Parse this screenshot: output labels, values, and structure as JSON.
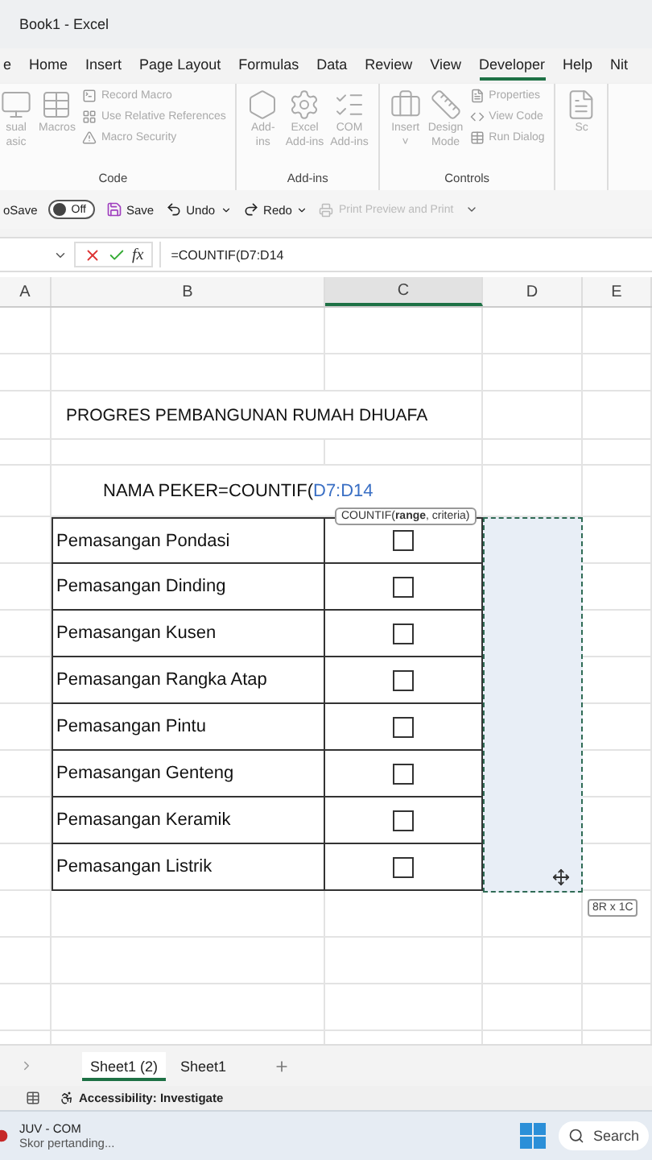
{
  "window": {
    "title": "Book1  -  Excel"
  },
  "ribbon_tabs": [
    {
      "label": "e",
      "selected": false
    },
    {
      "label": "Home",
      "selected": false
    },
    {
      "label": "Insert",
      "selected": false
    },
    {
      "label": "Page Layout",
      "selected": false
    },
    {
      "label": "Formulas",
      "selected": false
    },
    {
      "label": "Data",
      "selected": false
    },
    {
      "label": "Review",
      "selected": false
    },
    {
      "label": "View",
      "selected": false
    },
    {
      "label": "Developer",
      "selected": true
    },
    {
      "label": "Help",
      "selected": false
    },
    {
      "label": "Nit",
      "selected": false
    }
  ],
  "ribbon_groups": [
    {
      "label": "Code",
      "large": [
        {
          "label": "sual\nasic"
        },
        {
          "label": "Macros"
        }
      ],
      "small": [
        {
          "label": "Record Macro"
        },
        {
          "label": "Use Relative References"
        },
        {
          "label": "Macro Security"
        }
      ]
    },
    {
      "label": "Add-ins",
      "large": [
        {
          "label": "Add-\nins"
        },
        {
          "label": "Excel\nAdd-ins"
        },
        {
          "label": "COM\nAdd-ins"
        }
      ]
    },
    {
      "label": "Controls",
      "large": [
        {
          "label": "Insert\n˅"
        },
        {
          "label": "Design\nMode"
        }
      ],
      "small": [
        {
          "label": "Properties"
        },
        {
          "label": "View Code"
        },
        {
          "label": "Run Dialog"
        }
      ]
    },
    {
      "large": [
        {
          "label": "Sc"
        }
      ]
    }
  ],
  "quick_access": {
    "autosave_label": "oSave",
    "autosave": {
      "on": false,
      "label": "Off"
    },
    "save": "Save",
    "undo": "Undo",
    "redo": "Redo",
    "print": "Print Preview and Print"
  },
  "formula_bar": {
    "fx": "fx",
    "formula": "=COUNTIF(D7:D14"
  },
  "columns": [
    {
      "label": "A",
      "selected": false
    },
    {
      "label": "B",
      "selected": false
    },
    {
      "label": "C",
      "selected": true
    },
    {
      "label": "D",
      "selected": false
    },
    {
      "label": "E",
      "selected": false
    }
  ],
  "rows": [
    {
      "kind": "blank"
    },
    {
      "kind": "blank"
    },
    {
      "kind": "title",
      "text": "PROGRES PEMBANGUNAN RUMAH DHUAFA"
    },
    {
      "kind": "blank"
    },
    {
      "kind": "formula",
      "text": "NAMA PEKER=COUNTIF(",
      "range": "D7:D14"
    },
    {
      "kind": "task",
      "text": "Pemasangan Pondasi",
      "checked": false
    },
    {
      "kind": "task",
      "text": "Pemasangan Dinding",
      "checked": false
    },
    {
      "kind": "task",
      "text": "Pemasangan Kusen",
      "checked": false
    },
    {
      "kind": "task",
      "text": "Pemasangan Rangka Atap",
      "checked": false
    },
    {
      "kind": "task",
      "text": "Pemasangan Pintu",
      "checked": false
    },
    {
      "kind": "task",
      "text": "Pemasangan Genteng",
      "checked": false
    },
    {
      "kind": "task",
      "text": "Pemasangan Keramik",
      "checked": false
    },
    {
      "kind": "task",
      "text": "Pemasangan Listrik",
      "checked": false
    },
    {
      "kind": "blank"
    },
    {
      "kind": "blank"
    },
    {
      "kind": "blank"
    },
    {
      "kind": "blank"
    }
  ],
  "function_tooltip": "COUNTIF(**range**, criteria)",
  "selection_size": "8R x 1C",
  "sheet_tabs": [
    {
      "label": "Sheet1 (2)",
      "selected": true
    },
    {
      "label": "Sheet1",
      "selected": false
    }
  ],
  "status_bar": {
    "accessibility": "Accessibility: Investigate"
  },
  "taskbar": {
    "notification_title": "JUV - COM",
    "notification_text": "Skor pertanding...",
    "search": "Search"
  }
}
